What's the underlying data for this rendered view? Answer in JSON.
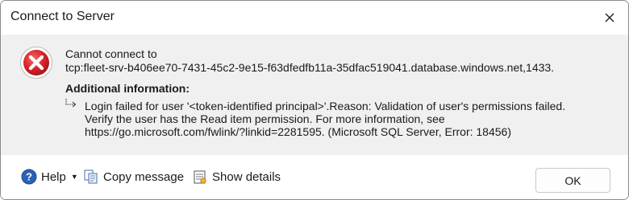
{
  "window": {
    "title": "Connect to Server",
    "close_icon": "close-icon"
  },
  "message": {
    "line1": "Cannot connect to",
    "line2": "tcp:fleet-srv-b406ee70-7431-45c2-9e15-f63dfedfb11a-35dfac519041.database.windows.net,1433.",
    "icon": "error-icon"
  },
  "additional": {
    "title": "Additional information:",
    "lines": [
      "Login failed for user '<token-identified principal>'.Reason: Validation of user's permissions failed.",
      "Verify the user has the Read item permission. For more information, see",
      "https://go.microsoft.com/fwlink/?linkid=2281595. (Microsoft SQL Server, Error: 18456)"
    ]
  },
  "footer": {
    "help_label": "Help",
    "copy_label": "Copy message",
    "details_label": "Show details",
    "ok_label": "OK"
  },
  "colors": {
    "error_red": "#d8262b",
    "help_blue": "#2b63b4",
    "body_bg": "#f0f0f0"
  }
}
